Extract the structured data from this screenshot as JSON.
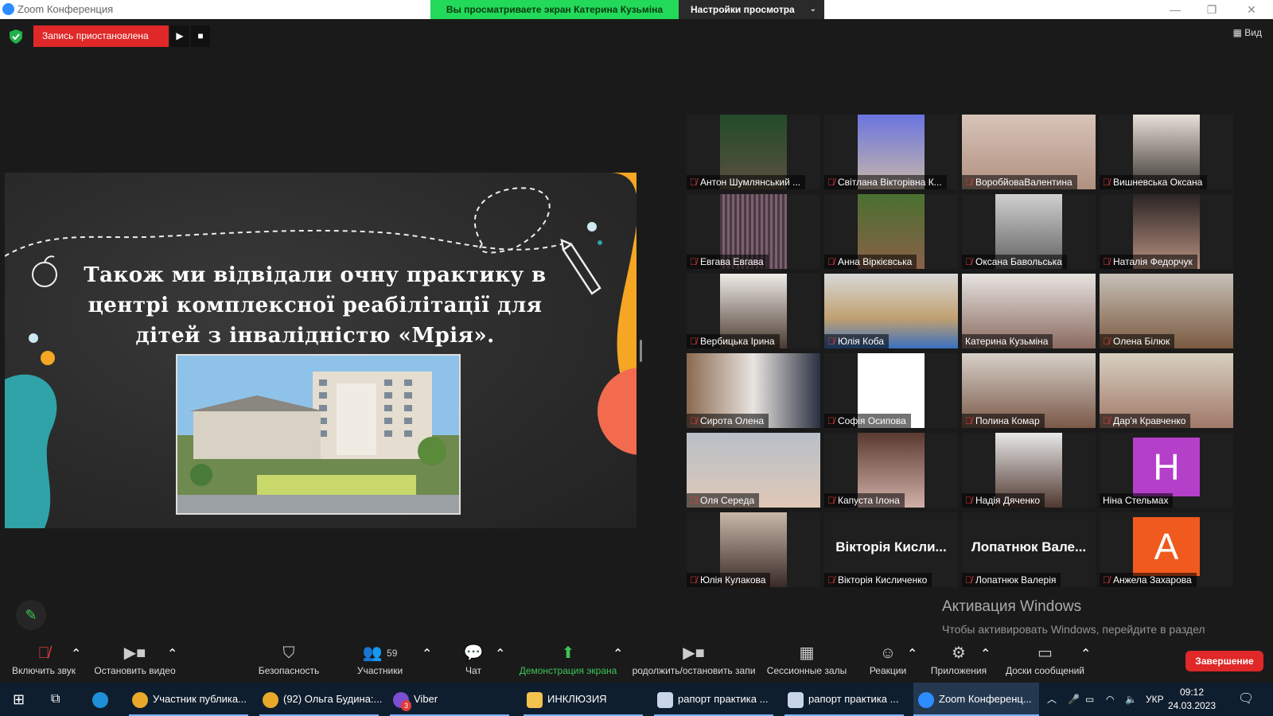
{
  "window": {
    "title": "Zoom Конференция",
    "viewing_banner": "Вы просматриваете экран Катерина Кузьміна",
    "view_settings": "Настройки просмотра",
    "view_button": "Вид"
  },
  "recording": {
    "status": "Запись приостановлена"
  },
  "slide": {
    "title": "Також ми відвідали очну практику в центрі комплексної реабілітації для дітей з інвалідністю «Мрія»."
  },
  "participants": [
    {
      "name": "Антон Шумлянський ...",
      "muted": true
    },
    {
      "name": "Світлана Вікторівна К...",
      "muted": true
    },
    {
      "name": "ВоробйоваВалентина",
      "muted": true
    },
    {
      "name": "Вишневська Оксана",
      "muted": true
    },
    {
      "name": "Евгава Евгава",
      "muted": true
    },
    {
      "name": "Анна Віркієвська",
      "muted": true
    },
    {
      "name": "Оксана Бавольська",
      "muted": true
    },
    {
      "name": "Наталія Федорчук",
      "muted": true
    },
    {
      "name": "Вербицька Ірина",
      "muted": true
    },
    {
      "name": "Юлія Коба",
      "muted": true
    },
    {
      "name": "Катерина Кузьміна",
      "muted": false
    },
    {
      "name": "Олена Білюк",
      "muted": true
    },
    {
      "name": "Сирота Олена",
      "muted": true
    },
    {
      "name": "Софія Осипова",
      "muted": true
    },
    {
      "name": "Полина Комар",
      "muted": true
    },
    {
      "name": "Дар'я Кравченко",
      "muted": true
    },
    {
      "name": "Оля Середа",
      "muted": true
    },
    {
      "name": "Капуста Ілона",
      "muted": true
    },
    {
      "name": "Надія Дяченко",
      "muted": true
    },
    {
      "name": "Ніна Стельмах",
      "muted": false,
      "avatar_letter": "Н",
      "avatar_color": "#b43fc9"
    },
    {
      "name": "Юлія Кулакова",
      "muted": true
    },
    {
      "name": "Вікторія Кисличенко",
      "muted": true,
      "display": "Вікторія Кисли..."
    },
    {
      "name": "Лопатнюк Валерія",
      "muted": true,
      "display": "Лопатнюк Вале..."
    },
    {
      "name": "Анжела Захарова",
      "muted": true,
      "avatar_letter": "А",
      "avatar_color": "#f05a1e"
    }
  ],
  "activation": {
    "title": "Активация Windows",
    "text": "Чтобы активировать Windows, перейдите в раздел \"Параметры\"."
  },
  "toolbar": {
    "unmute": "Включить звук",
    "stop_video": "Остановить видео",
    "security": "Безопасность",
    "participants": "Участники",
    "participants_count": "59",
    "chat": "Чат",
    "share": "Демонстрация экрана",
    "record": "родолжить/остановить запи",
    "breakout": "Сессионные залы",
    "reactions": "Реакции",
    "apps": "Приложения",
    "whiteboards": "Доски сообщений",
    "end": "Завершение"
  },
  "taskbar": {
    "items": [
      "Участник публика...",
      "(92) Ольга Будина:...",
      "Viber",
      "ИНКЛЮЗИЯ",
      "рапорт практика ...",
      "рапорт практика ...",
      "Zoom Конференц..."
    ],
    "viber_badge": "3",
    "lang": "УКР",
    "time": "09:12",
    "date": "24.03.2023"
  },
  "colors": {
    "accent_green": "#23d959",
    "record_red": "#e02828",
    "active_speaker": "#c8d84a"
  }
}
